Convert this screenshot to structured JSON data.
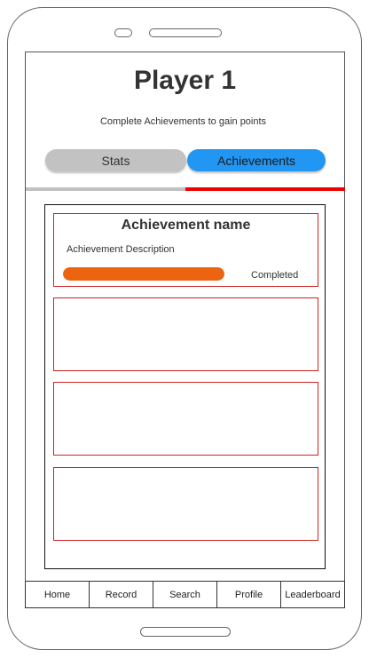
{
  "header": {
    "title": "Player 1",
    "subtitle": "Complete Achievements to gain points"
  },
  "tabs": [
    {
      "label": "Stats",
      "active": false,
      "color": "#c2c2c2"
    },
    {
      "label": "Achievements",
      "active": true,
      "color": "#2196f3"
    }
  ],
  "colors": {
    "tab_indicator_active": "#ee0000",
    "tab_indicator_inactive": "#c0c0c0",
    "card_border": "#cc2222",
    "progress": "#ec6410"
  },
  "achievements": [
    {
      "name": "Achievement name",
      "description": "Achievement Description",
      "progress": 1.0,
      "status": "Completed"
    },
    {},
    {},
    {}
  ],
  "navbar": {
    "items": [
      "Home",
      "Record",
      "Search",
      "Profile",
      "Leaderboard"
    ]
  }
}
